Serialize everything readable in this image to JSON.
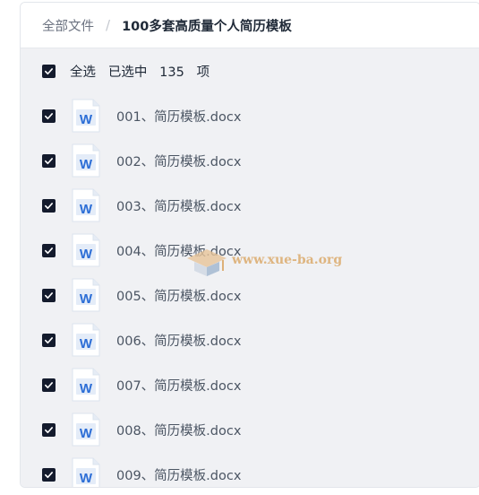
{
  "breadcrumb": {
    "root": "全部文件",
    "separator": "/",
    "current": "100多套高质量个人简历模板"
  },
  "selection": {
    "select_all_label": "全选",
    "selected_prefix": "已选中",
    "selected_count": "135",
    "selected_unit": "项",
    "checked": true
  },
  "files": [
    {
      "name": "001、简历模板.docx",
      "icon": "word-doc-icon",
      "checked": true
    },
    {
      "name": "002、简历模板.docx",
      "icon": "word-doc-icon",
      "checked": true
    },
    {
      "name": "003、简历模板.docx",
      "icon": "word-doc-icon",
      "checked": true
    },
    {
      "name": "004、简历模板.docx",
      "icon": "word-doc-icon",
      "checked": true
    },
    {
      "name": "005、简历模板.docx",
      "icon": "word-doc-icon",
      "checked": true
    },
    {
      "name": "006、简历模板.docx",
      "icon": "word-doc-icon",
      "checked": true
    },
    {
      "name": "007、简历模板.docx",
      "icon": "word-doc-icon",
      "checked": true
    },
    {
      "name": "008、简历模板.docx",
      "icon": "word-doc-icon",
      "checked": true
    },
    {
      "name": "009、简历模板.docx",
      "icon": "word-doc-icon",
      "checked": true
    }
  ],
  "watermark": {
    "text": "www.xue-ba.org"
  },
  "colors": {
    "checkbox": "#141b2d",
    "word_blue": "#2b6dd6",
    "list_background": "#f0f1f4"
  }
}
